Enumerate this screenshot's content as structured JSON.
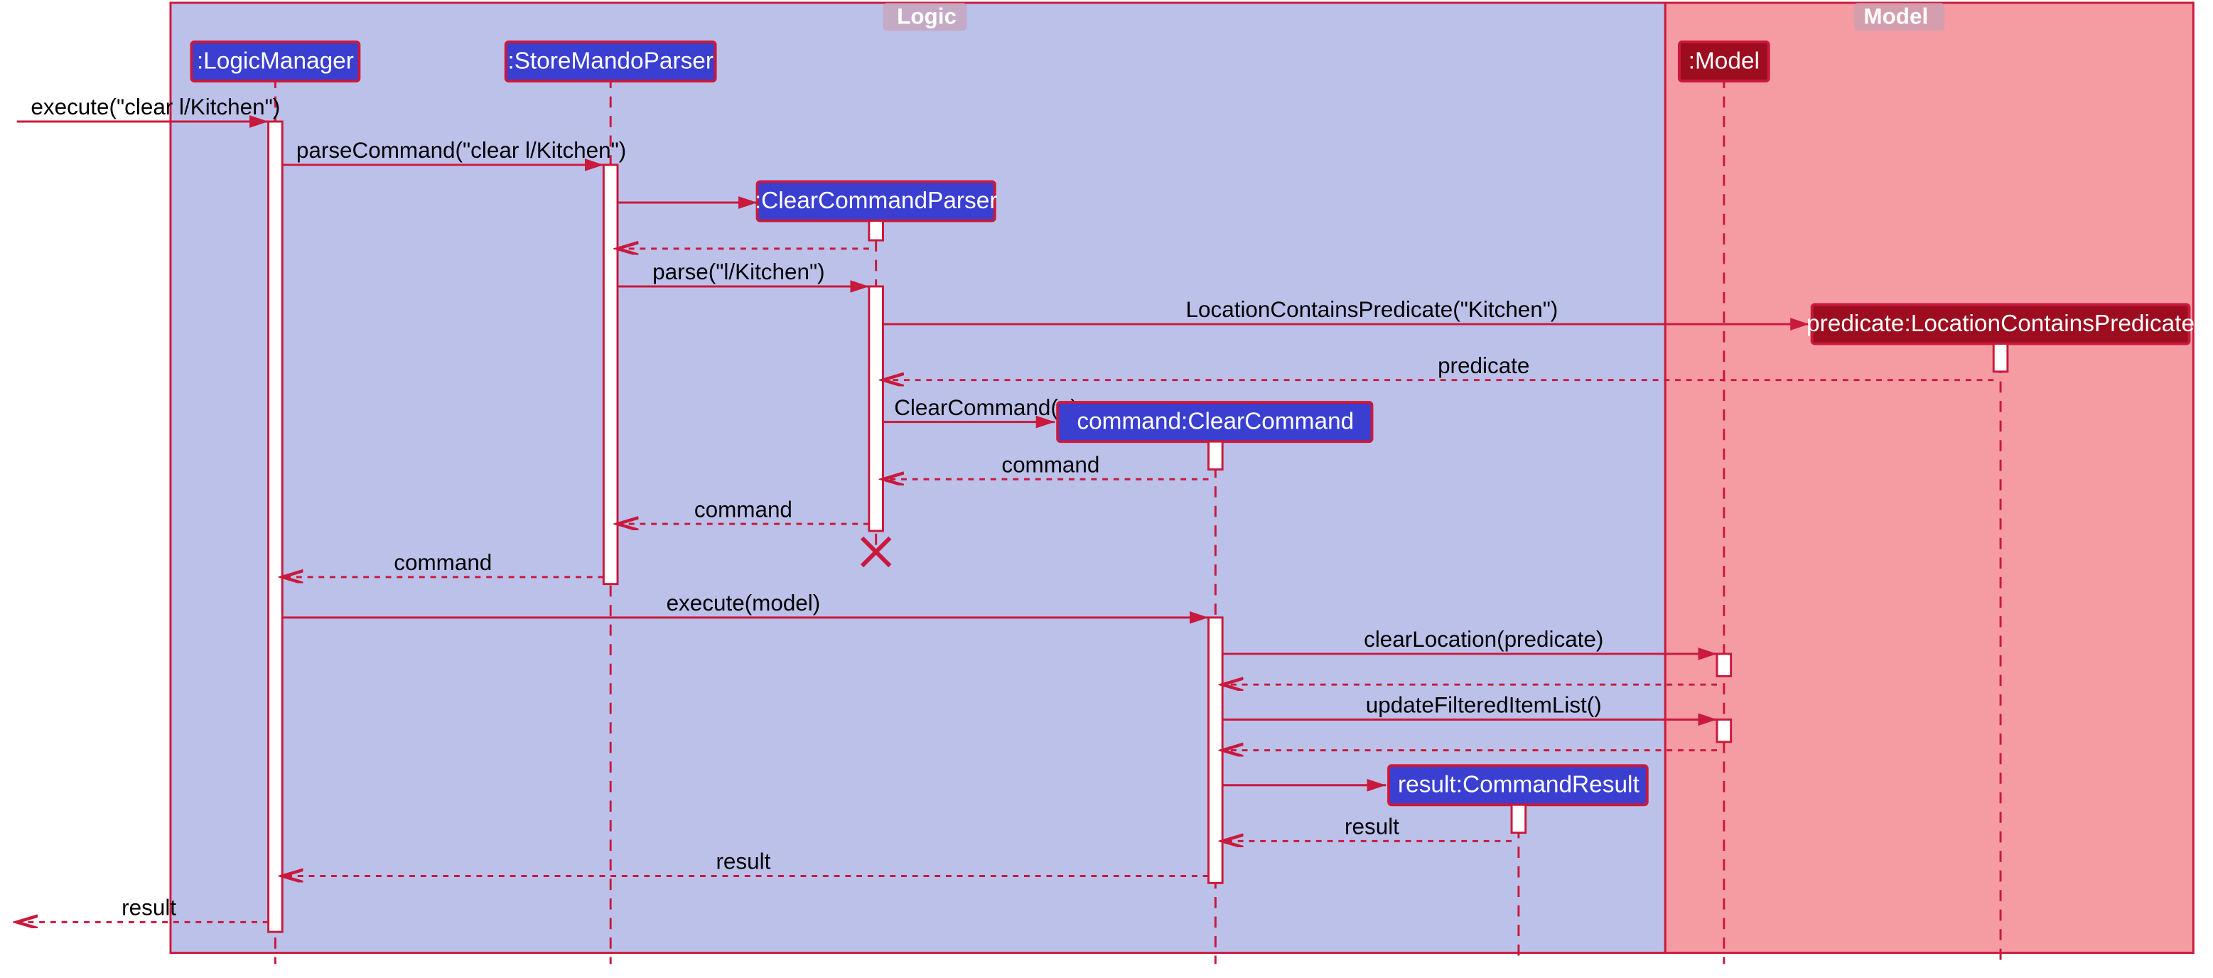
{
  "frames": {
    "logic": "Logic",
    "model": "Model"
  },
  "participants": {
    "logicManager": ":LogicManager",
    "storeMandoParser": ":StoreMandoParser",
    "clearCommandParser": ":ClearCommandParser",
    "clearCommand": "command:ClearCommand",
    "commandResult": "result:CommandResult",
    "model": ":Model",
    "predicate": "predicate:LocationContainsPredicate"
  },
  "messages": {
    "m1": "execute(\"clear l/Kitchen\")",
    "m2": "parseCommand(\"clear l/Kitchen\")",
    "m3": "parse(\"l/Kitchen\")",
    "m4": "LocationContainsPredicate(\"Kitchen\")",
    "m5": "predicate",
    "m6": "ClearCommand(p)",
    "m7": "command",
    "m8": "command",
    "m9": "command",
    "m10": "execute(model)",
    "m11": "clearLocation(predicate)",
    "m12": "updateFilteredItemList()",
    "m13": "result",
    "m14": "result",
    "m15": "result"
  }
}
